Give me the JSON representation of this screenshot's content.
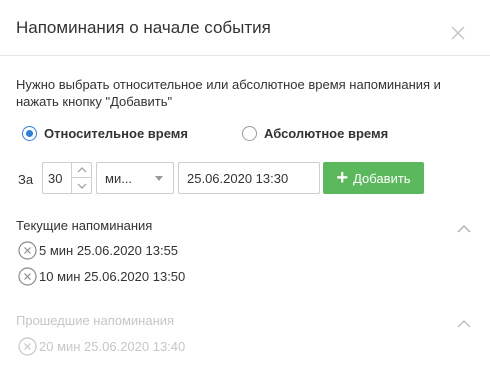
{
  "dialog": {
    "title": "Напоминания о начале события",
    "description": "Нужно выбрать относительное или абсолютное время напоминания и нажать кнопку \"Добавить\""
  },
  "mode": {
    "relative_label": "Относительное время",
    "absolute_label": "Абсолютное время",
    "selected": "relative"
  },
  "form": {
    "prefix_label": "За",
    "amount": "30",
    "unit": "ми...",
    "datetime": "25.06.2020 13:30",
    "add_label": "Добавить"
  },
  "current": {
    "title": "Текущие напоминания",
    "items": [
      {
        "text": "5 мин 25.06.2020 13:55"
      },
      {
        "text": "10 мин 25.06.2020 13:50"
      }
    ]
  },
  "past": {
    "title": "Прошедшие напоминания",
    "items": [
      {
        "text": "20 мин 25.06.2020 13:40"
      }
    ]
  },
  "colors": {
    "accent": "#2f7fd6",
    "add_button": "#5cb85c",
    "past_text": "#c6c6c6"
  }
}
